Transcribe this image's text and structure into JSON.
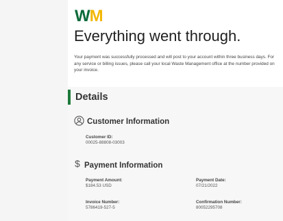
{
  "logo": {
    "part_w": "W",
    "part_m": "M"
  },
  "headline": "Everything went through.",
  "message": "Your payment was successfully processed and will post to your account within three business days. For any service or billing issues, please call your local Waste Management office at the number provided on your invoice.",
  "details": {
    "title": "Details",
    "customer_information": {
      "title": "Customer Information",
      "icon": "person-circle-icon",
      "fields": [
        {
          "label": "Customer ID:",
          "value": "00025-88808-03003"
        }
      ]
    },
    "payment_information": {
      "title": "Payment Information",
      "icon": "dollar-icon",
      "icon_glyph": "$",
      "fields": [
        {
          "label": "Payment Amount:",
          "value": "$184.53 USD"
        },
        {
          "label": "Payment Date:",
          "value": "07/21/2022"
        },
        {
          "label": "Invoice Number:",
          "value": "5786419-527-5"
        },
        {
          "label": "Confirmation Number:",
          "value": "80052295708"
        }
      ]
    }
  },
  "colors": {
    "brand_green": "#0a6b3a",
    "brand_yellow": "#f2b705",
    "accent_bar": "#1d7a3a",
    "details_background": "#f7f7f7",
    "gutter_background": "#f5f5f5"
  }
}
